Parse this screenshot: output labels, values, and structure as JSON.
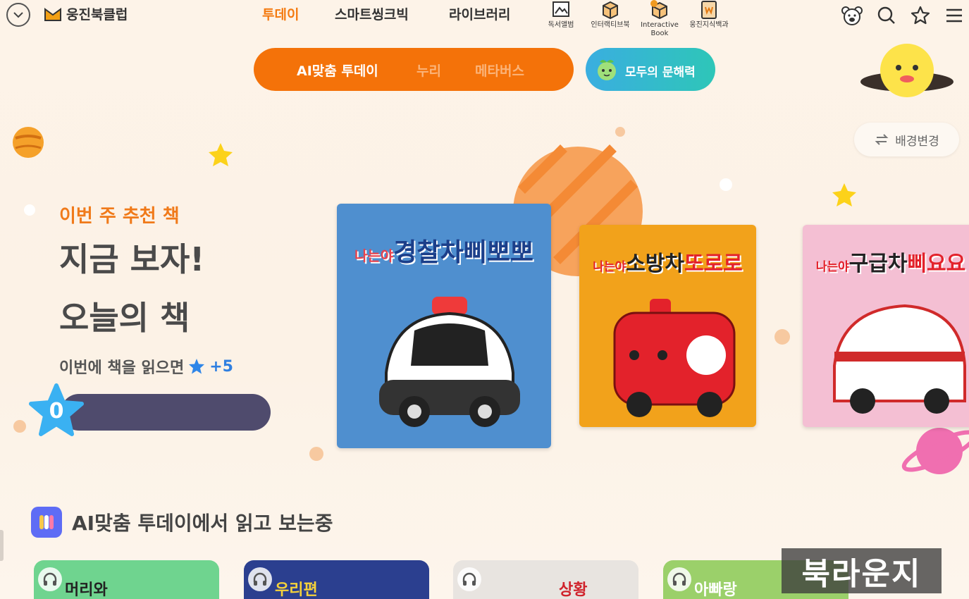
{
  "header": {
    "logo_text": "웅진북클럽",
    "nav": [
      {
        "label": "투데이",
        "active": true
      },
      {
        "label": "스마트씽크빅",
        "active": false
      },
      {
        "label": "라이브러리",
        "active": false
      }
    ],
    "services": [
      {
        "label": "독서앨범",
        "icon": "album-icon"
      },
      {
        "label": "인터랙티브북",
        "icon": "box-icon"
      },
      {
        "label": "Interactive Book",
        "icon": "en-box-icon"
      },
      {
        "label": "웅진지식백과",
        "icon": "encyclopedia-icon"
      }
    ],
    "right_icons": [
      "bear-profile-icon",
      "search-icon",
      "star-icon",
      "hamburger-menu-icon"
    ]
  },
  "subnav": {
    "tabs": [
      {
        "label": "AI맞춤 투데이",
        "active": true
      },
      {
        "label": "누리",
        "active": false
      },
      {
        "label": "메타버스",
        "active": false
      }
    ],
    "literacy_button": "모두의 문해력"
  },
  "hero": {
    "eyebrow": "이번 주 추천 책",
    "title_line1": "지금 보자!",
    "title_line2": "오늘의 책",
    "reward_text": "이번에 책을 읽으면",
    "reward_value": "+5",
    "star_count": "0",
    "background_change": "배경변경",
    "books": [
      {
        "title_prefix": "나는야",
        "title_main": "경찰차",
        "title_name": "삐뽀뽀",
        "color": "#4f8fcf"
      },
      {
        "title_prefix": "나는야",
        "title_main": "소방차",
        "title_name": "또로로",
        "color": "#f2a21b"
      },
      {
        "title_prefix": "나는야",
        "title_main": "구급차",
        "title_name": "삐요요",
        "color": "#f4bfd3"
      }
    ]
  },
  "section": {
    "title": "AI맞춤 투데이에서 읽고 보는중",
    "cards": [
      {
        "text": "머리와",
        "color": "#6fd48f"
      },
      {
        "text": "우리편",
        "color": "#2b3f8f"
      },
      {
        "text": "상황",
        "color": "#e8e4e0"
      },
      {
        "text": "아빠랑",
        "color": "#9bd06a"
      }
    ]
  },
  "watermark": "북라운지",
  "colors": {
    "accent": "#f47209",
    "text": "#444444",
    "bar": "#4f4b6d"
  }
}
